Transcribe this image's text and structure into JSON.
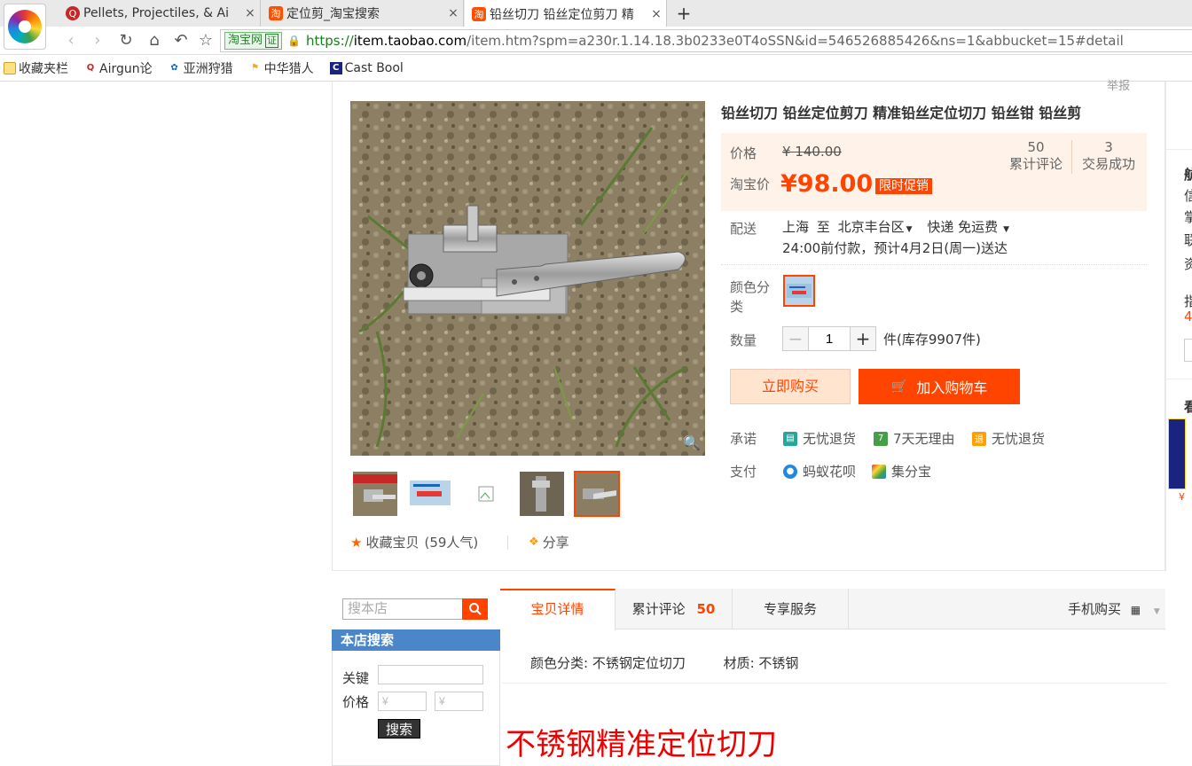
{
  "browser": {
    "tabs": [
      {
        "title": "Pellets, Projectiles, & Ai",
        "favicon": "airgun-forum-icon",
        "active": false
      },
      {
        "title": "定位剪_淘宝搜索",
        "favicon": "taobao-icon",
        "active": false
      },
      {
        "title": "铅丝切刀 铅丝定位剪刀 精",
        "favicon": "taobao-icon",
        "active": true
      }
    ],
    "new_tab_label": "+",
    "site_badge": "淘宝网",
    "site_badge_cert": "证",
    "url_scheme": "https://",
    "url_domain": "item.taobao.com",
    "url_path": "/item.htm?spm=a230r.1.14.18.3b0233e0T4oSSN&id=546526885426&ns=1&abbucket=15#detail",
    "bookmarks": [
      {
        "label": "收藏夹栏",
        "icon": "folder-icon"
      },
      {
        "label": "Airgun论",
        "icon": "airgun-forum-icon"
      },
      {
        "label": "亚洲狩猎",
        "icon": "asia-hunting-icon"
      },
      {
        "label": "中华猎人",
        "icon": "china-hunter-icon"
      },
      {
        "label": "Cast Bool",
        "icon": "cast-bool-icon"
      }
    ]
  },
  "product": {
    "report": "举报",
    "title": "铅丝切刀 铅丝定位剪刀 精准铅丝定位切刀 铅丝钳 铅丝剪",
    "price_label": "价格",
    "original_price": "¥ 140.00",
    "promo_price_label": "淘宝价",
    "current_price": "¥98.00",
    "promo_tag": "限时促销",
    "reviews_count": "50",
    "reviews_label": "累计评论",
    "deals_count": "3",
    "deals_label": "交易成功",
    "shipping_label": "配送",
    "ship_from": "上海",
    "ship_to_word": "至",
    "ship_to": "北京丰台区",
    "ship_method": "快递 免运费",
    "delivery_note": "24:00前付款，预计4月2日(周一)送达",
    "color_label_1": "颜色分",
    "color_label_2": "类",
    "qty_label": "数量",
    "qty_value": "1",
    "stock": "件(库存9907件)",
    "buy_now": "立即购买",
    "add_cart": "加入购物车",
    "promise_label": "承诺",
    "promises": [
      "无忧退货",
      "7天无理由",
      "无忧退货"
    ],
    "pay_label": "支付",
    "payments": [
      "蚂蚁花呗",
      "集分宝"
    ],
    "collect": "收藏宝贝",
    "collect_count": "(59人气)",
    "share": "分享"
  },
  "sidebar_fragments": [
    "航",
    "信",
    "掌",
    "联",
    "资",
    "指",
    "4",
    "看",
    "¥"
  ],
  "shop": {
    "search_placeholder": "搜本店",
    "bar_title": "本店搜索",
    "keyword_label": "关键",
    "price_label": "价格",
    "price_placeholder": "¥",
    "search_button": "搜索"
  },
  "detail_tabs": {
    "tabs": [
      "宝贝详情",
      "累计评论",
      "专享服务"
    ],
    "review_count": "50",
    "mobile_buy": "手机购买"
  },
  "detail": {
    "attr1": "颜色分类: 不锈钢定位切刀",
    "attr2": "材质: 不锈钢",
    "big_title": "不锈钢精准定位切刀"
  },
  "colors": {
    "accent": "#ff4400",
    "price_bg": "#fff2e8",
    "shop_bar": "#4a86c8"
  }
}
